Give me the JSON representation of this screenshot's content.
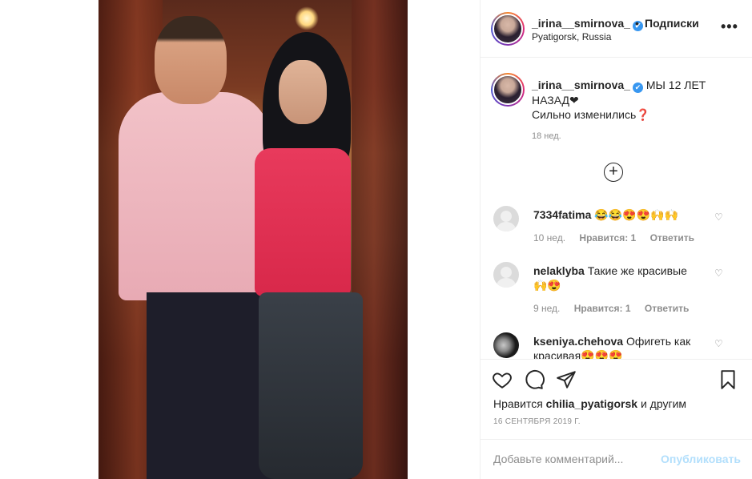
{
  "post": {
    "photo_alt": "photo",
    "header": {
      "username": "_irina__smirnova_",
      "verified_glyph": "✔",
      "dot": "•",
      "follow_label": "Подписки",
      "location": "Pyatigorsk, Russia",
      "more_icon": "more-dots-icon",
      "more_glyph": "•••"
    },
    "caption": {
      "username": "_irina__smirnova_",
      "line1": "МЫ 12 ЛЕТ НАЗАД❤",
      "line2": "Сильно изменились❓",
      "time": "18 нед."
    },
    "load_more_glyph": "+",
    "comments": [
      {
        "username": "7334fatima",
        "text": "😂😂😍😍🙌🙌",
        "time": "10 нед.",
        "likes": "Нравится: 1",
        "reply": "Ответить"
      },
      {
        "username": "nelaklyba",
        "text": "Такие же красивые 🙌😍",
        "time": "9 нед.",
        "likes": "Нравится: 1",
        "reply": "Ответить"
      },
      {
        "username": "kseniya.chehova",
        "text": "Офигеть как красивая😍😍😍",
        "time": "",
        "likes": "",
        "reply": ""
      }
    ],
    "comment_like_glyph": "♡",
    "likes_prefix": "Нравится",
    "likes_user": "chilia_pyatigorsk",
    "likes_suffix": "и другим",
    "date": "16 СЕНТЯБРЯ 2019 Г.",
    "add_comment": {
      "placeholder": "Добавьте комментарий...",
      "publish_label": "Опубликовать"
    },
    "colors": {
      "link_disabled": "#b2dffc",
      "verified": "#3897f0",
      "muted": "#8e8e8e"
    }
  }
}
